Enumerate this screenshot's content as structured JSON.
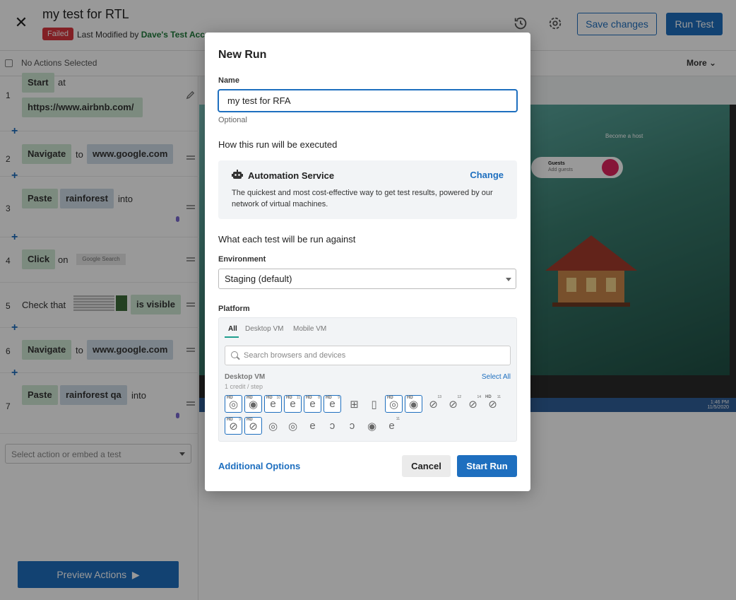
{
  "header": {
    "test_title": "my test for RTL",
    "status": "Failed",
    "modified_prefix": "Last Modified by",
    "modified_by": "Dave's Test Acc",
    "save_label": "Save changes",
    "run_label": "Run Test"
  },
  "subbar": {
    "selection_text": "No Actions Selected",
    "more_label": "More"
  },
  "steps": [
    {
      "num": "1",
      "action": "Start",
      "connector": "at",
      "target": "https://www.airbnb.com/"
    },
    {
      "num": "2",
      "action": "Navigate",
      "connector": "to",
      "target": "www.google.com"
    },
    {
      "num": "3",
      "action": "Paste",
      "target": "rainforest",
      "connector": "into"
    },
    {
      "num": "4",
      "action": "Click",
      "connector": "on",
      "target": "Google Search"
    },
    {
      "num": "5",
      "prefix": "Check that",
      "action": "is visible"
    },
    {
      "num": "6",
      "action": "Navigate",
      "connector": "to",
      "target": "www.google.com"
    },
    {
      "num": "7",
      "action": "Paste",
      "target": "rainforest qa",
      "connector": "into"
    }
  ],
  "left_panel": {
    "select_action_placeholder": "Select action or embed a test",
    "preview_label": "Preview Actions"
  },
  "browser": {
    "site_nav_1": "Become a host",
    "site_guests": "Guests",
    "site_add_guests": "Add guests",
    "tray_time": "1:46 PM",
    "tray_date": "11/5/2020"
  },
  "modal": {
    "title": "New Run",
    "name_label": "Name",
    "name_value": "my test for RFA",
    "name_helper": "Optional",
    "executed_heading": "How this run will be executed",
    "service": {
      "name": "Automation Service",
      "change_label": "Change",
      "description": "The quickest and most cost-effective way to get test results, powered by our network of virtual machines."
    },
    "against_heading": "What each test will be run against",
    "environment_label": "Environment",
    "environment_value": "Staging (default)",
    "platform_label": "Platform",
    "platform_tabs": [
      "All",
      "Desktop VM",
      "Mobile VM"
    ],
    "platform_search_placeholder": "Search browsers and devices",
    "group_name": "Desktop VM",
    "group_credit": "1 credit / step",
    "select_all_label": "Select All",
    "additional_options_label": "Additional Options",
    "cancel_label": "Cancel",
    "start_label": "Start Run"
  },
  "colors": {
    "accent": "#1e6fbf",
    "failed": "#d9363e",
    "chip_green": "#cfe8d4",
    "chip_blue": "#cfdde8"
  }
}
